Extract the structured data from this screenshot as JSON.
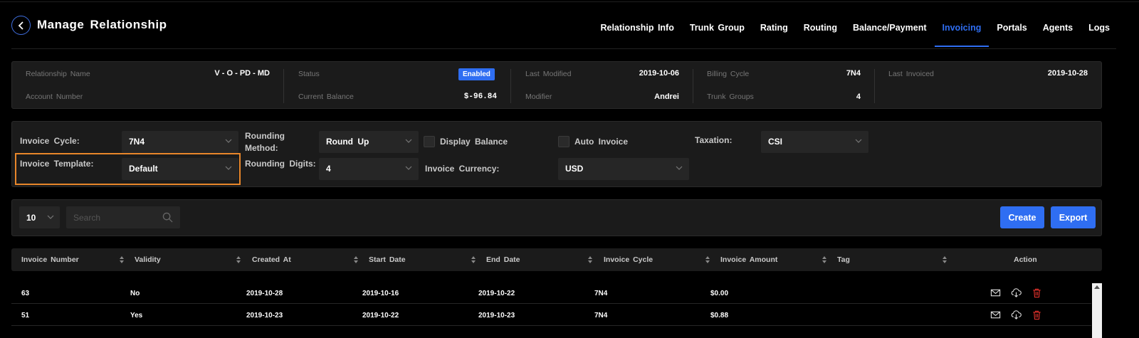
{
  "header": {
    "title": "Manage Relationship",
    "tabs": [
      {
        "label": "Relationship Info"
      },
      {
        "label": "Trunk Group"
      },
      {
        "label": "Rating"
      },
      {
        "label": "Routing"
      },
      {
        "label": "Balance/Payment"
      },
      {
        "label": "Invoicing",
        "active": true
      },
      {
        "label": "Portals"
      },
      {
        "label": "Agents"
      },
      {
        "label": "Logs"
      }
    ]
  },
  "info": {
    "relationship_name_label": "Relationship Name",
    "relationship_name": "V - O - PD - MD",
    "account_number_label": "Account Number",
    "status_label": "Status",
    "status": "Enabled",
    "current_balance_label": "Current Balance",
    "current_balance": "$-96.84",
    "last_modified_label": "Last Modified",
    "last_modified": "2019-10-06",
    "modifier_label": "Modifier",
    "modifier": "Andrei",
    "billing_cycle_label": "Billing Cycle",
    "billing_cycle": "7N4",
    "trunk_groups_label": "Trunk Groups",
    "trunk_groups": "4",
    "last_invoiced_label": "Last Invoiced",
    "last_invoiced": "2019-10-28"
  },
  "settings": {
    "invoice_cycle_label": "Invoice Cycle:",
    "invoice_cycle": "7N4",
    "invoice_template_label": "Invoice Template:",
    "invoice_template": "Default",
    "rounding_method_label": "Rounding Method:",
    "rounding_method": "Round Up",
    "rounding_digits_label": "Rounding Digits:",
    "rounding_digits": "4",
    "display_balance_label": "Display Balance",
    "auto_invoice_label": "Auto Invoice",
    "invoice_currency_label": "Invoice Currency:",
    "invoice_currency": "USD",
    "taxation_label": "Taxation:",
    "taxation": "CSI"
  },
  "toolbar": {
    "page_size": "10",
    "search_placeholder": "Search",
    "create_label": "Create",
    "export_label": "Export"
  },
  "table": {
    "columns": [
      "Invoice Number",
      "Validity",
      "Created At",
      "Start Date",
      "End Date",
      "Invoice Cycle",
      "Invoice Amount",
      "Tag",
      "Action"
    ],
    "rows": [
      {
        "invoice_number": "63",
        "validity": "No",
        "created_at": "2019-10-28",
        "start_date": "2019-10-16",
        "end_date": "2019-10-22",
        "invoice_cycle": "7N4",
        "invoice_amount": "$0.00",
        "tag": ""
      },
      {
        "invoice_number": "51",
        "validity": "Yes",
        "created_at": "2019-10-23",
        "start_date": "2019-10-22",
        "end_date": "2019-10-23",
        "invoice_cycle": "7N4",
        "invoice_amount": "$0.88",
        "tag": ""
      }
    ]
  },
  "icons": {
    "back": "chevron-left-icon",
    "dropdown": "chevron-down-icon",
    "search": "search-icon",
    "sort": "sort-icon",
    "email": "mail-icon",
    "download": "cloud-download-icon",
    "delete": "trash-icon"
  },
  "colors": {
    "accent": "#2f6ef2",
    "highlight": "#e8862a",
    "delete": "#e0312b",
    "panel": "#1b1b1b",
    "background": "#000000"
  }
}
